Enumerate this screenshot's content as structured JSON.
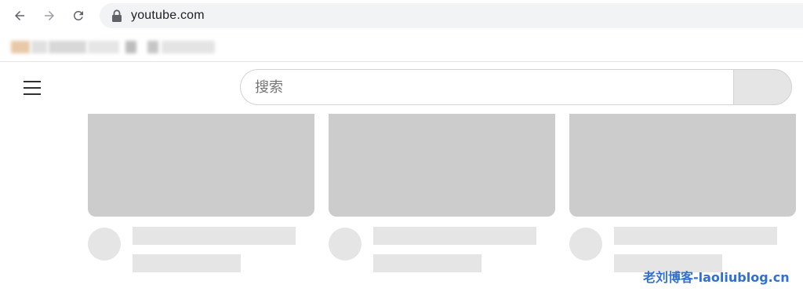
{
  "browser": {
    "url": "youtube.com",
    "icons": {
      "back": "arrow-left-icon",
      "forward": "arrow-right-icon",
      "reload": "reload-icon",
      "lock": "lock-icon"
    }
  },
  "bookmarks": {
    "blurred_count": 7
  },
  "youtube": {
    "menu_icon": "hamburger-menu-icon",
    "search": {
      "placeholder": "搜索"
    },
    "video_cards": [
      {
        "state": "loading-placeholder"
      },
      {
        "state": "loading-placeholder"
      },
      {
        "state": "loading-placeholder"
      }
    ]
  },
  "colors": {
    "placeholder_thumb": "#cccccc",
    "placeholder_line": "#e5e5e5",
    "search_button": "#e5e5e5",
    "omnibox": "#f1f3f4",
    "watermark": "#2f6fd6"
  },
  "watermark": {
    "text": "老刘博客-laoliublog.cn"
  }
}
